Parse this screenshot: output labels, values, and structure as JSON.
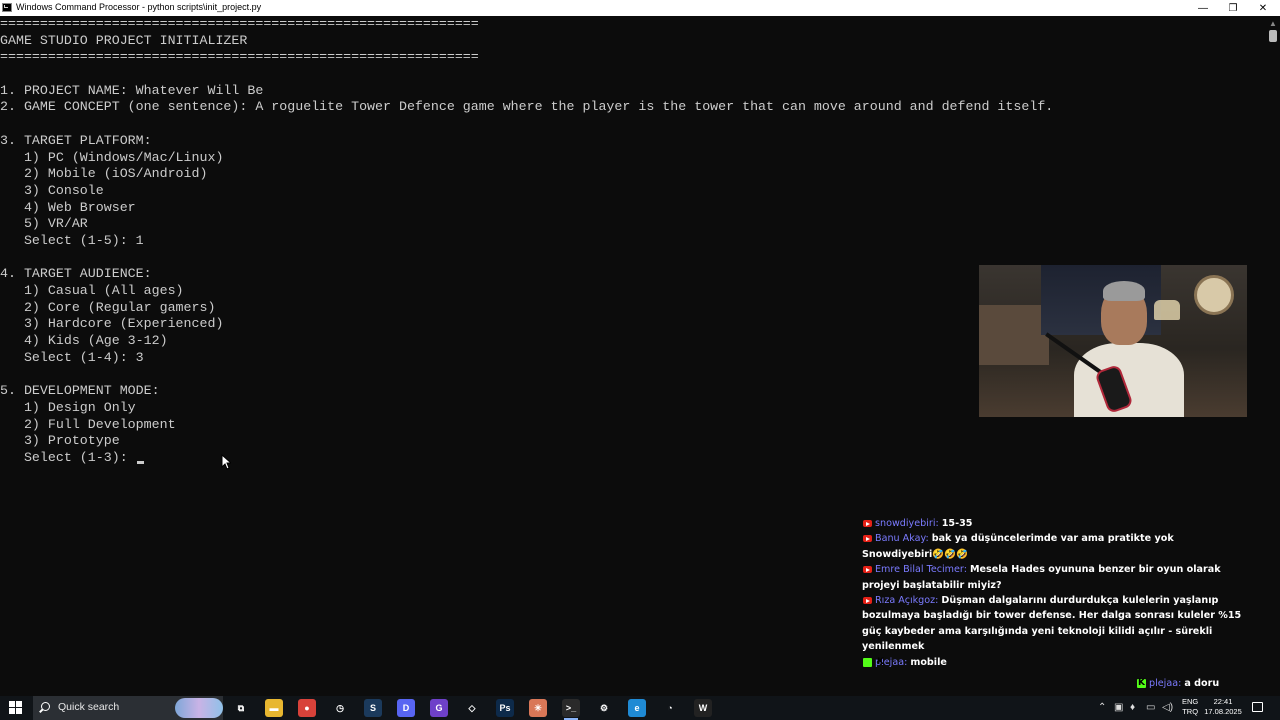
{
  "window": {
    "title": "Windows Command Processor - python  scripts\\init_project.py",
    "min_glyph": "—",
    "max_glyph": "❐",
    "close_glyph": "✕"
  },
  "terminal": {
    "lines": [
      "============================================================",
      "GAME STUDIO PROJECT INITIALIZER",
      "============================================================",
      "",
      "1. PROJECT NAME: Whatever Will Be",
      "2. GAME CONCEPT (one sentence): A roguelite Tower Defence game where the player is the tower that can move around and defend itself.",
      "",
      "3. TARGET PLATFORM:",
      "   1) PC (Windows/Mac/Linux)",
      "   2) Mobile (iOS/Android)",
      "   3) Console",
      "   4) Web Browser",
      "   5) VR/AR",
      "   Select (1-5): 1",
      "",
      "4. TARGET AUDIENCE:",
      "   1) Casual (All ages)",
      "   2) Core (Regular gamers)",
      "   3) Hardcore (Experienced)",
      "   4) Kids (Age 3-12)",
      "   Select (1-4): 3",
      "",
      "5. DEVELOPMENT MODE:",
      "   1) Design Only",
      "   2) Full Development",
      "   3) Prototype",
      "   Select (1-3): "
    ]
  },
  "chat": {
    "messages": [
      {
        "platform": "youtube",
        "user": "snowdiyebiri:",
        "user_color": "#7b7bff",
        "text": "15-35"
      },
      {
        "platform": "youtube",
        "user": "Banu Akay:",
        "user_color": "#7b7bff",
        "text": "bak ya düşüncelerimde var ama pratikte yok Snowdiyebiri🤣🤣🤣"
      },
      {
        "platform": "youtube",
        "user": "Emre Bilal Tecimer:",
        "user_color": "#7b7bff",
        "text": "Mesela Hades oyununa benzer bir oyun olarak projeyi başlatabilir miyiz?"
      },
      {
        "platform": "youtube",
        "user": "Rıza Açıkgoz:",
        "user_color": "#7b7bff",
        "text": "Düşman dalgalarını durdurdukça kulelerin yaşlanıp bozulmaya başladığı bir tower defense. Her dalga sonrası kuleler %15 güç kaybeder ama karşılığında yeni teknoloji kilidi açılır - sürekli yenilenmek"
      },
      {
        "platform": "kick",
        "user": "plejaa:",
        "user_color": "#7b7bff",
        "text": "mobile"
      }
    ],
    "last": {
      "platform": "kick",
      "user": "plejaa:",
      "user_color": "#7b7bff",
      "text": "a doru"
    }
  },
  "taskbar": {
    "search_label": "Quick search",
    "apps": [
      {
        "name": "task-view",
        "glyph": "⧉",
        "color": "transparent"
      },
      {
        "name": "file-explorer",
        "glyph": "▬",
        "color": "#e8b730"
      },
      {
        "name": "chrome",
        "glyph": "●",
        "color": "#d8423a"
      },
      {
        "name": "clock-app",
        "glyph": "◷",
        "color": "transparent"
      },
      {
        "name": "steam",
        "glyph": "S",
        "color": "#1b3a5c"
      },
      {
        "name": "discord",
        "glyph": "D",
        "color": "#5865f2"
      },
      {
        "name": "github",
        "glyph": "G",
        "color": "#6e40c9"
      },
      {
        "name": "unity",
        "glyph": "◇",
        "color": "transparent"
      },
      {
        "name": "photoshop",
        "glyph": "Ps",
        "color": "#0d2a4a"
      },
      {
        "name": "claude",
        "glyph": "✳",
        "color": "#d97757"
      },
      {
        "name": "terminal",
        "glyph": ">_",
        "color": "#2a2a2a"
      },
      {
        "name": "settings",
        "glyph": "⚙",
        "color": "transparent"
      },
      {
        "name": "edge",
        "glyph": "e",
        "color": "#1f8ad4"
      },
      {
        "name": "history",
        "glyph": "◔",
        "color": "transparent"
      },
      {
        "name": "capcut",
        "glyph": "W",
        "color": "#222"
      }
    ],
    "tray": {
      "lang_top": "ENG",
      "lang_bottom": "TRQ",
      "time": "22:41",
      "date": "17.08.2025"
    }
  }
}
